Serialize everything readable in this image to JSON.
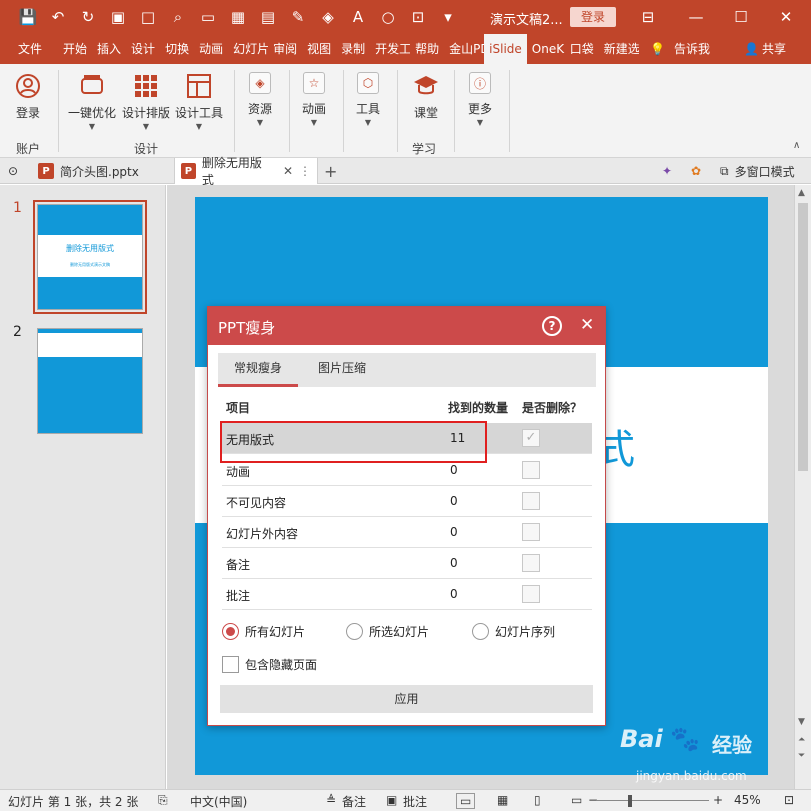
{
  "app": {
    "doc_title": "演示文稿2...",
    "login_label": "登录"
  },
  "colors": {
    "accent": "#c0452a",
    "slide_blue": "#1198d8",
    "dialog_red": "#cc4a4a",
    "highlight_box": "#e02020"
  },
  "tabs": [
    "文件",
    "开始",
    "插入",
    "设计",
    "切换",
    "动画",
    "幻灯片",
    "审阅",
    "视图",
    "录制",
    "开发工",
    "帮助",
    "金山PD",
    "iSlide",
    "OneK",
    "口袋",
    "新建选",
    "告诉我",
    "共享"
  ],
  "active_tab": "iSlide",
  "ribbon": {
    "account": {
      "login": "登录",
      "group": "账户"
    },
    "design": {
      "one_click": "一键优化",
      "layout": "设计排版",
      "tools": "设计工具",
      "group": "设计"
    },
    "resources": "资源",
    "animation": "动画",
    "tool": "工具",
    "classroom": "课堂",
    "learn_group": "学习",
    "more": "更多"
  },
  "doc_tabs": {
    "tab1": "简介头图.pptx",
    "tab2": "删除无用版式",
    "multi_window": "多窗口模式"
  },
  "thumbnails": [
    {
      "num": "1",
      "title": "删除无用版式",
      "subtitle": "删除无用版式演示文稿"
    },
    {
      "num": "2"
    }
  ],
  "slide": {
    "partial_char": "式"
  },
  "dialog": {
    "title": "PPT瘦身",
    "help": "?",
    "close": "✕",
    "tabs": [
      "常规瘦身",
      "图片压缩"
    ],
    "headers": {
      "item": "项目",
      "count": "找到的数量",
      "delete": "是否删除？"
    },
    "rows": [
      {
        "name": "无用版式",
        "count": "11",
        "checked": true
      },
      {
        "name": "动画",
        "count": "0",
        "checked": false
      },
      {
        "name": "不可见内容",
        "count": "0",
        "checked": false
      },
      {
        "name": "幻灯片外内容",
        "count": "0",
        "checked": false
      },
      {
        "name": "备注",
        "count": "0",
        "checked": false
      },
      {
        "name": "批注",
        "count": "0",
        "checked": false
      }
    ],
    "scope": {
      "all": "所有幻灯片",
      "selected": "所选幻灯片",
      "sequence": "幻灯片序列",
      "selected_option": "所有幻灯片"
    },
    "include_hidden": "包含隐藏页面",
    "apply": "应用"
  },
  "status": {
    "slide_info": "幻灯片 第 1 张，共 2 张",
    "language": "中文(中国)",
    "notes": "备注",
    "comments": "批注",
    "zoom": "45%"
  },
  "watermark": {
    "brand": "Bai",
    "brand2": "经验",
    "url": "jingyan.baidu.com"
  }
}
